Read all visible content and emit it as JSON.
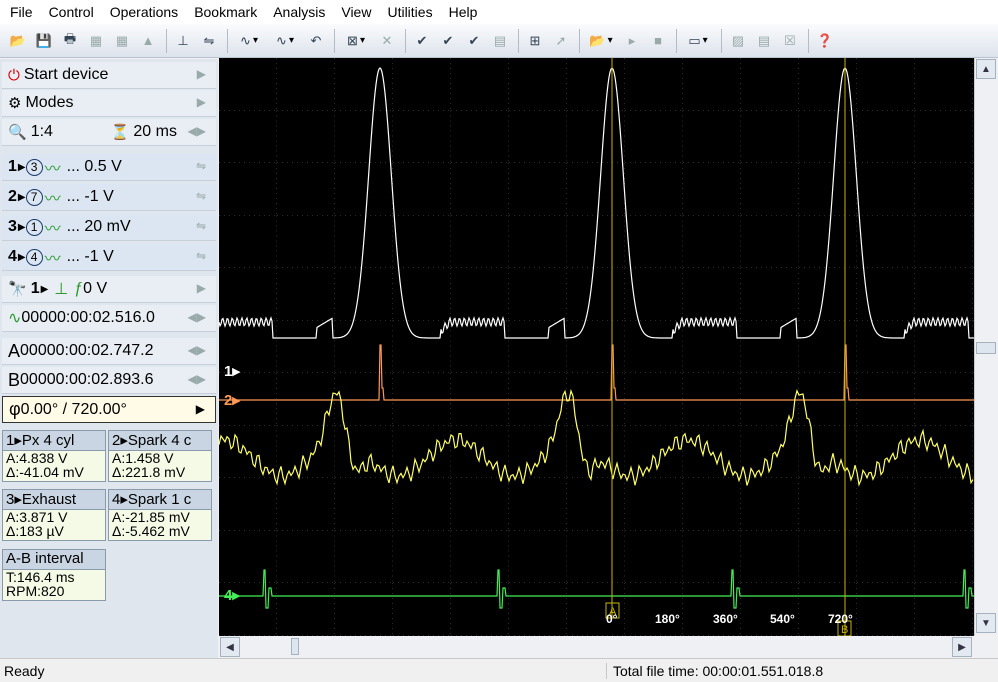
{
  "menu": [
    "File",
    "Control",
    "Operations",
    "Bookmark",
    "Analysis",
    "View",
    "Utilities",
    "Help"
  ],
  "panel": {
    "start": "Start device",
    "modes": "Modes",
    "zoom": "1:4",
    "timebase": "20 ms",
    "channels": [
      {
        "num": "1",
        "probe": "3",
        "scale": "... 0.5 V"
      },
      {
        "num": "2",
        "probe": "7",
        "scale": "... -1 V"
      },
      {
        "num": "3",
        "probe": "1",
        "scale": "... 20 mV"
      },
      {
        "num": "4",
        "probe": "4",
        "scale": "... -1 V"
      }
    ],
    "trigger": {
      "channel": "1",
      "level": "0 V"
    },
    "position": "00000:00:02.516.0",
    "cursor_a": "00000:00:02.747.2",
    "cursor_b": "00000:00:02.893.6",
    "phase": "0.00° / 720.00°",
    "measures": [
      {
        "head": "1▸Px 4 cyl",
        "a": "A:4.838 V",
        "d": "Δ:-41.04 mV"
      },
      {
        "head": "2▸Spark 4 c",
        "a": "A:1.458 V",
        "d": "Δ:221.8 mV"
      },
      {
        "head": "3▸Exhaust",
        "a": "A:3.871 V",
        "d": "Δ:183 µV"
      },
      {
        "head": "4▸Spark 1 c",
        "a": "A:-21.85 mV",
        "d": "Δ:-5.462 mV"
      }
    ],
    "interval": {
      "head": "A-B interval",
      "t": "T:146.4 ms",
      "rpm": "RPM:820"
    }
  },
  "scope": {
    "markers": [
      "1▸",
      "2▸",
      "4▸"
    ],
    "phase_labels": [
      "0°",
      "180°",
      "360°",
      "540°",
      "720°"
    ],
    "cursor_a_label": "A",
    "cursor_b_label": "B"
  },
  "status": {
    "left": "Ready",
    "right": "Total file time: 00:00:01.551.018.8"
  },
  "colors": {
    "ch1": "#ffffff",
    "ch2": "#ff9955",
    "ch3": "#ffff66",
    "ch4": "#44ee55",
    "cursor": "#c8b400"
  }
}
